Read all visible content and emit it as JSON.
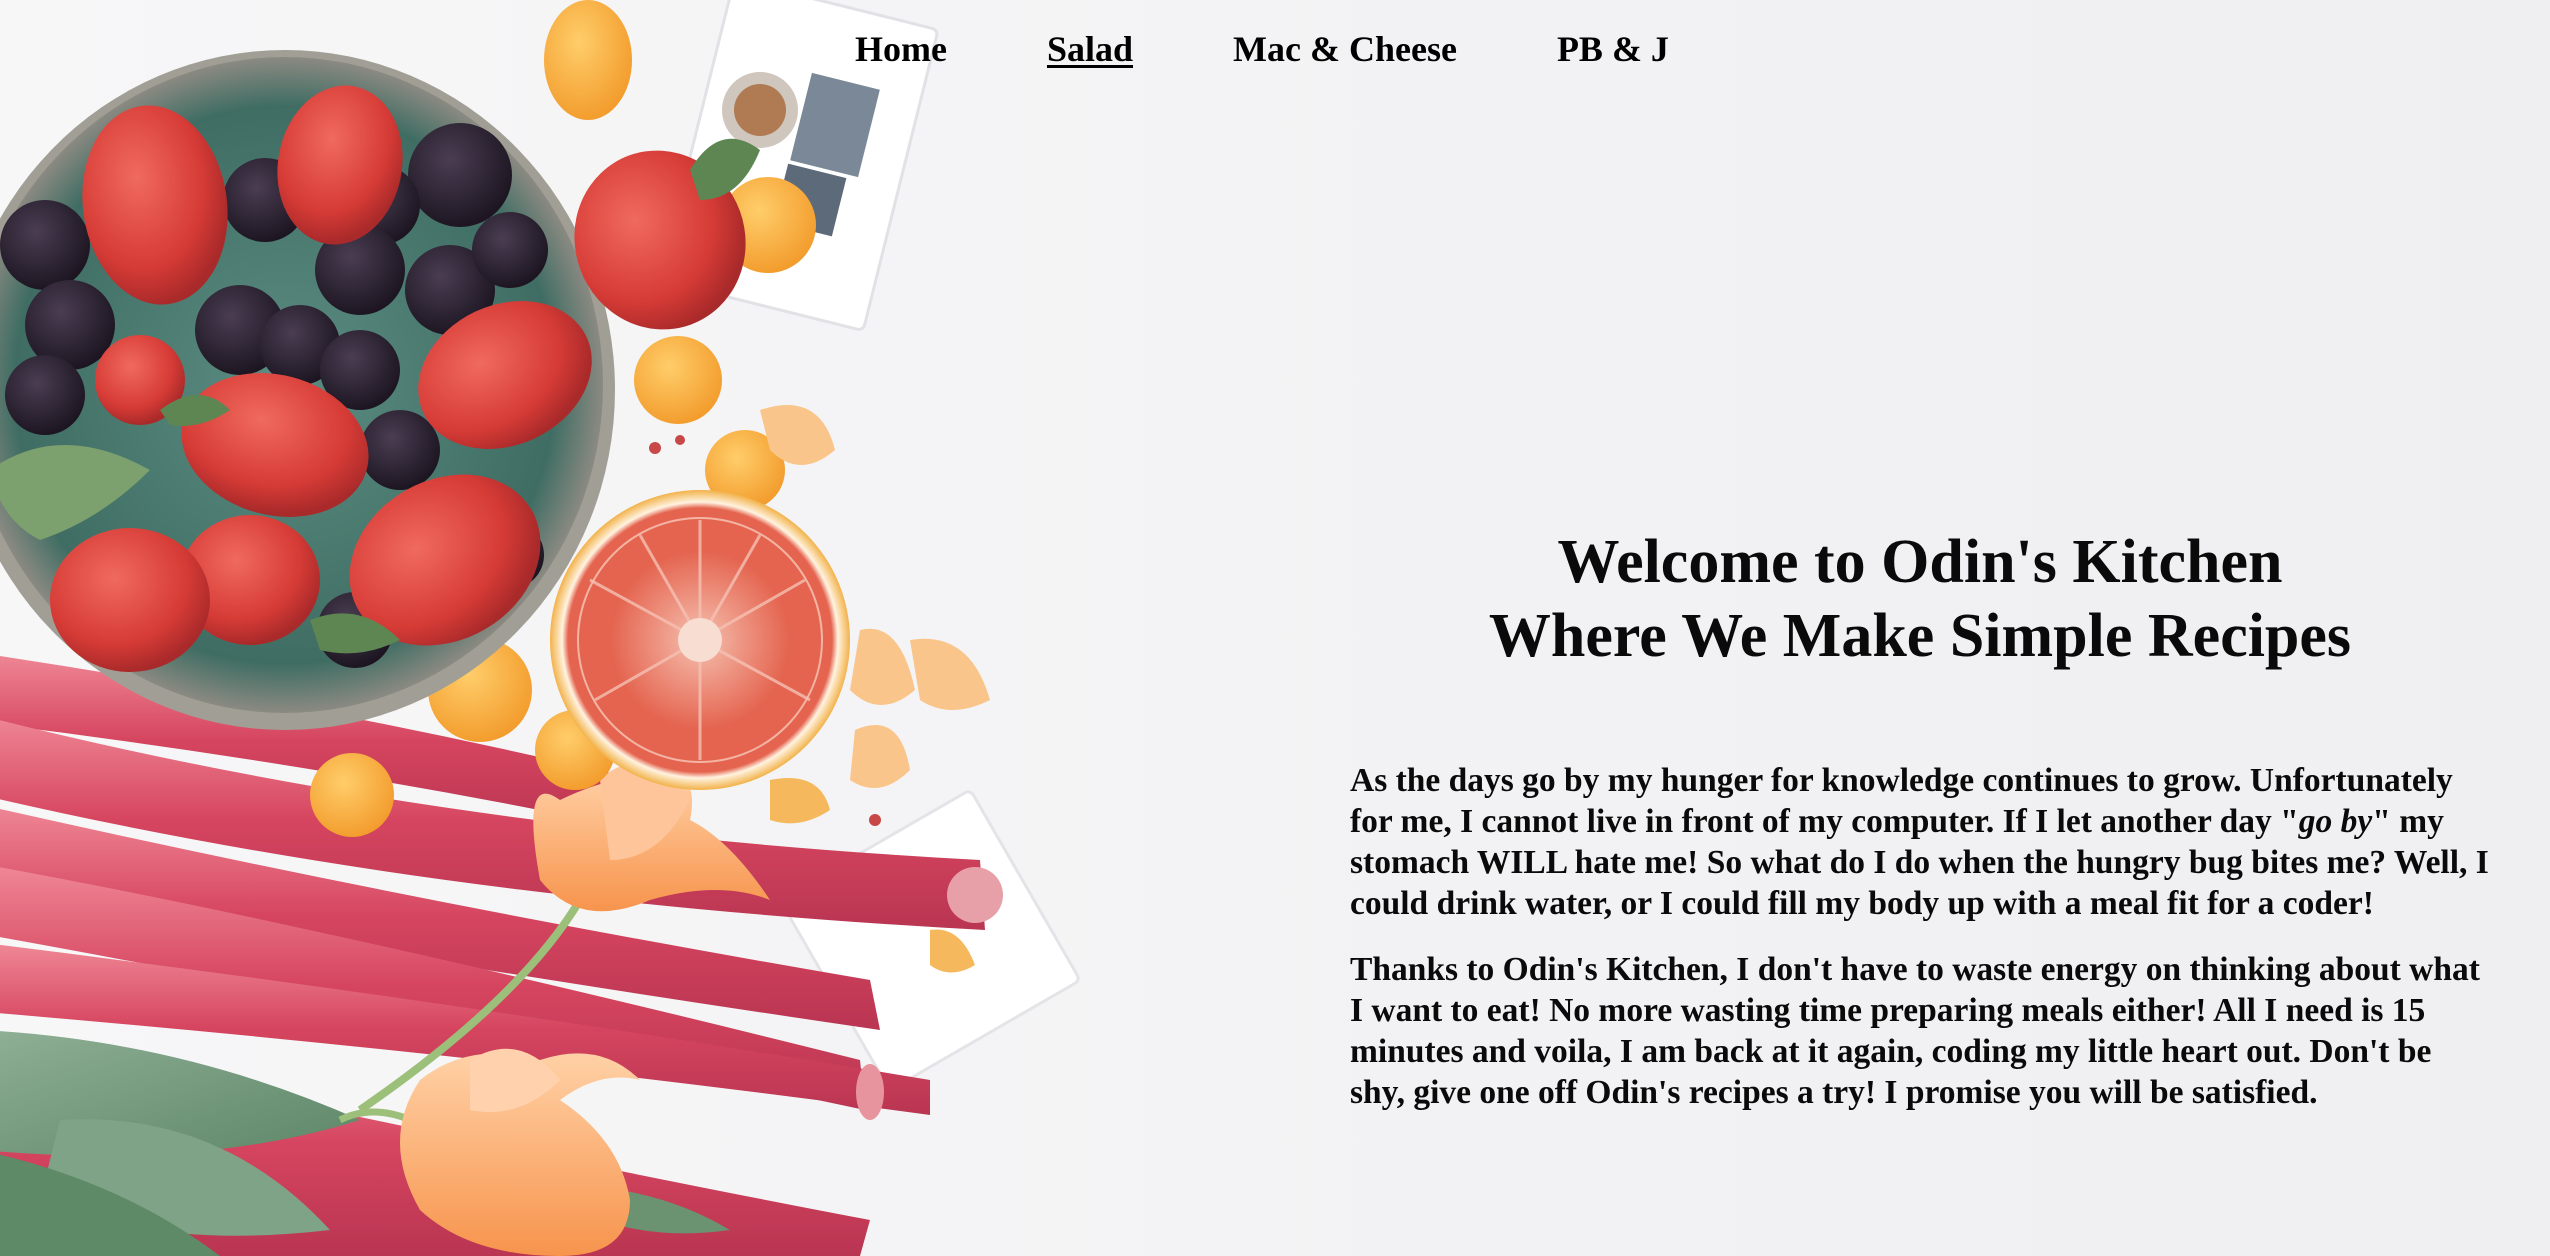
{
  "nav": {
    "items": [
      {
        "label": "Home",
        "active": false
      },
      {
        "label": "Salad",
        "active": true
      },
      {
        "label": "Mac & Cheese",
        "active": false
      },
      {
        "label": "PB & J",
        "active": false
      }
    ]
  },
  "hero": {
    "title_line1": "Welcome to Odin's Kitchen",
    "title_line2": "Where We Make Simple Recipes"
  },
  "content": {
    "p1_before": "As the days go by my hunger for knowledge continues to grow. Unfortunately for me, I cannot live in front of my computer. If I let another day \"",
    "p1_em": "go by",
    "p1_after": "\" my stomach WILL hate me! So what do I do when the hungry bug bites me? Well, I could drink water, or I could fill my body up with a meal fit for a coder!",
    "p2": "Thanks to Odin's Kitchen, I don't have to waste energy on thinking about what I want to eat! No more wasting time preparing meals either! All I need is 15 minutes and voila, I am back at it again, coding my little heart out. Don't be shy, give one off Odin's recipes a try! I promise you will be satisfied."
  },
  "colors": {
    "background": "#f4f4f6",
    "text": "#000000",
    "strawberry": "#d8453e",
    "blackberry": "#2a2230",
    "rhubarb": "#d9506a",
    "orange": "#f4a93a",
    "bowl": "#4d7d72"
  }
}
